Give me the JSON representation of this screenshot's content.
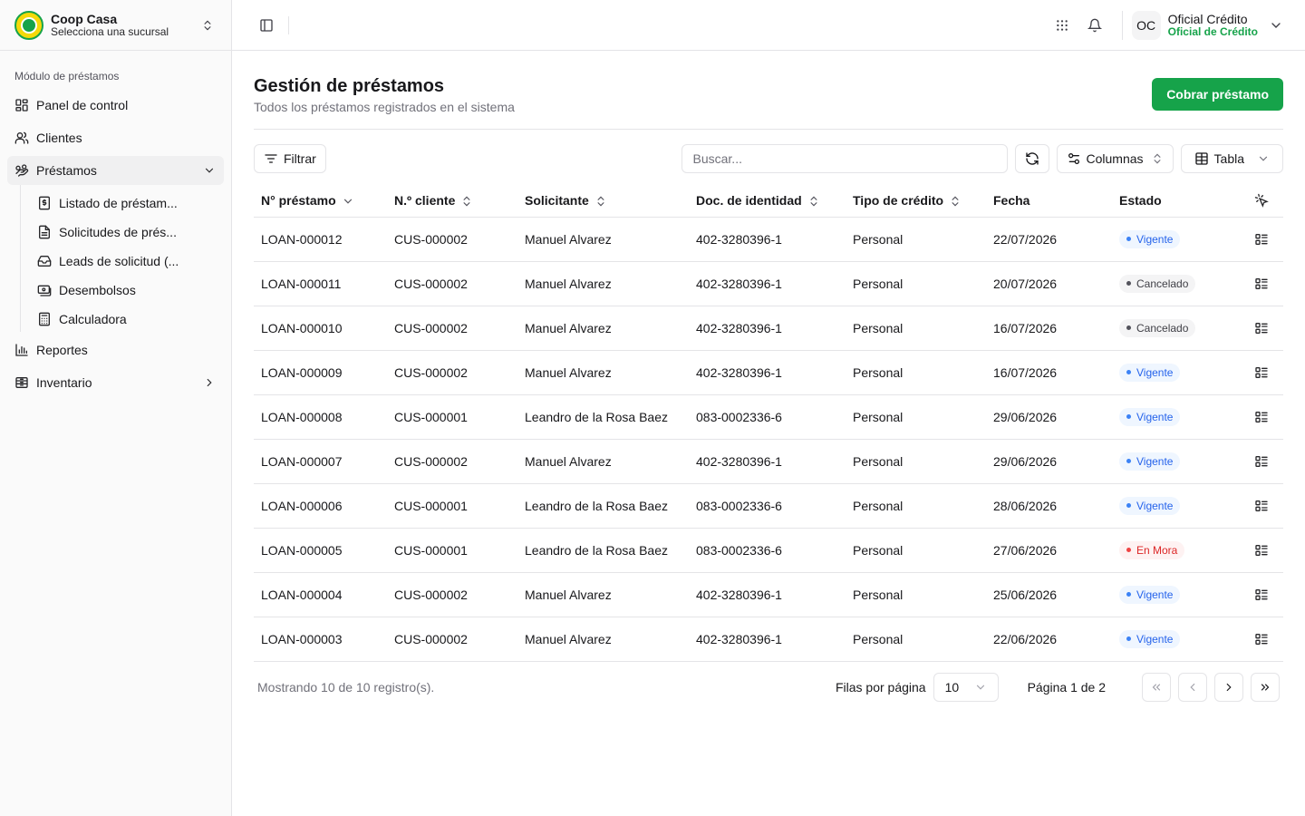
{
  "brand": {
    "name": "Coop Casa",
    "subtitle": "Selecciona una sucursal"
  },
  "sidebar": {
    "group_label": "Módulo de préstamos",
    "items": [
      {
        "label": "Panel de control",
        "icon": "dashboard-icon"
      },
      {
        "label": "Clientes",
        "icon": "users-icon"
      },
      {
        "label": "Préstamos",
        "icon": "loans-icon",
        "expanded": true,
        "children": [
          {
            "label": "Listado de préstam...",
            "icon": "document-dollar-icon"
          },
          {
            "label": "Solicitudes de prés...",
            "icon": "document-icon"
          },
          {
            "label": "Leads de solicitud (...",
            "icon": "inbox-icon"
          },
          {
            "label": "Desembolsos",
            "icon": "money-transfer-icon"
          },
          {
            "label": "Calculadora",
            "icon": "calculator-icon"
          }
        ]
      },
      {
        "label": "Reportes",
        "icon": "bar-chart-icon"
      },
      {
        "label": "Inventario",
        "icon": "archive-icon"
      }
    ]
  },
  "user": {
    "initials": "OC",
    "name": "Oficial Crédito",
    "role": "Oficial de Crédito"
  },
  "page": {
    "title": "Gestión de préstamos",
    "subtitle": "Todos los préstamos registrados en el sistema",
    "primary_action": "Cobrar préstamo"
  },
  "toolbar": {
    "filter_label": "Filtrar",
    "search_placeholder": "Buscar...",
    "columns_label": "Columnas",
    "view_label": "Tabla"
  },
  "table": {
    "columns": [
      "N° préstamo",
      "N.º cliente",
      "Solicitante",
      "Doc. de identidad",
      "Tipo de crédito",
      "Fecha",
      "Estado"
    ],
    "rows": [
      {
        "loan": "LOAN-000012",
        "client": "CUS-000002",
        "applicant": "Manuel Alvarez",
        "doc": "402-3280396-1",
        "type": "Personal",
        "date": "22/07/2026",
        "status": "Vigente",
        "status_kind": "vigente"
      },
      {
        "loan": "LOAN-000011",
        "client": "CUS-000002",
        "applicant": "Manuel Alvarez",
        "doc": "402-3280396-1",
        "type": "Personal",
        "date": "20/07/2026",
        "status": "Cancelado",
        "status_kind": "cancelado"
      },
      {
        "loan": "LOAN-000010",
        "client": "CUS-000002",
        "applicant": "Manuel Alvarez",
        "doc": "402-3280396-1",
        "type": "Personal",
        "date": "16/07/2026",
        "status": "Cancelado",
        "status_kind": "cancelado"
      },
      {
        "loan": "LOAN-000009",
        "client": "CUS-000002",
        "applicant": "Manuel Alvarez",
        "doc": "402-3280396-1",
        "type": "Personal",
        "date": "16/07/2026",
        "status": "Vigente",
        "status_kind": "vigente"
      },
      {
        "loan": "LOAN-000008",
        "client": "CUS-000001",
        "applicant": "Leandro de la Rosa Baez",
        "doc": "083-0002336-6",
        "type": "Personal",
        "date": "29/06/2026",
        "status": "Vigente",
        "status_kind": "vigente"
      },
      {
        "loan": "LOAN-000007",
        "client": "CUS-000002",
        "applicant": "Manuel Alvarez",
        "doc": "402-3280396-1",
        "type": "Personal",
        "date": "29/06/2026",
        "status": "Vigente",
        "status_kind": "vigente"
      },
      {
        "loan": "LOAN-000006",
        "client": "CUS-000001",
        "applicant": "Leandro de la Rosa Baez",
        "doc": "083-0002336-6",
        "type": "Personal",
        "date": "28/06/2026",
        "status": "Vigente",
        "status_kind": "vigente"
      },
      {
        "loan": "LOAN-000005",
        "client": "CUS-000001",
        "applicant": "Leandro de la Rosa Baez",
        "doc": "083-0002336-6",
        "type": "Personal",
        "date": "27/06/2026",
        "status": "En Mora",
        "status_kind": "mora"
      },
      {
        "loan": "LOAN-000004",
        "client": "CUS-000002",
        "applicant": "Manuel Alvarez",
        "doc": "402-3280396-1",
        "type": "Personal",
        "date": "25/06/2026",
        "status": "Vigente",
        "status_kind": "vigente"
      },
      {
        "loan": "LOAN-000003",
        "client": "CUS-000002",
        "applicant": "Manuel Alvarez",
        "doc": "402-3280396-1",
        "type": "Personal",
        "date": "22/06/2026",
        "status": "Vigente",
        "status_kind": "vigente"
      }
    ]
  },
  "pagination": {
    "summary": "Mostrando 10 de 10 registro(s).",
    "rows_per_page_label": "Filas por página",
    "rows_per_page_value": "10",
    "page_info": "Página 1 de 2"
  },
  "colors": {
    "accent": "#16a34a",
    "vigente": "#2563eb",
    "cancelado": "#3f3f46",
    "mora": "#dc2626"
  }
}
